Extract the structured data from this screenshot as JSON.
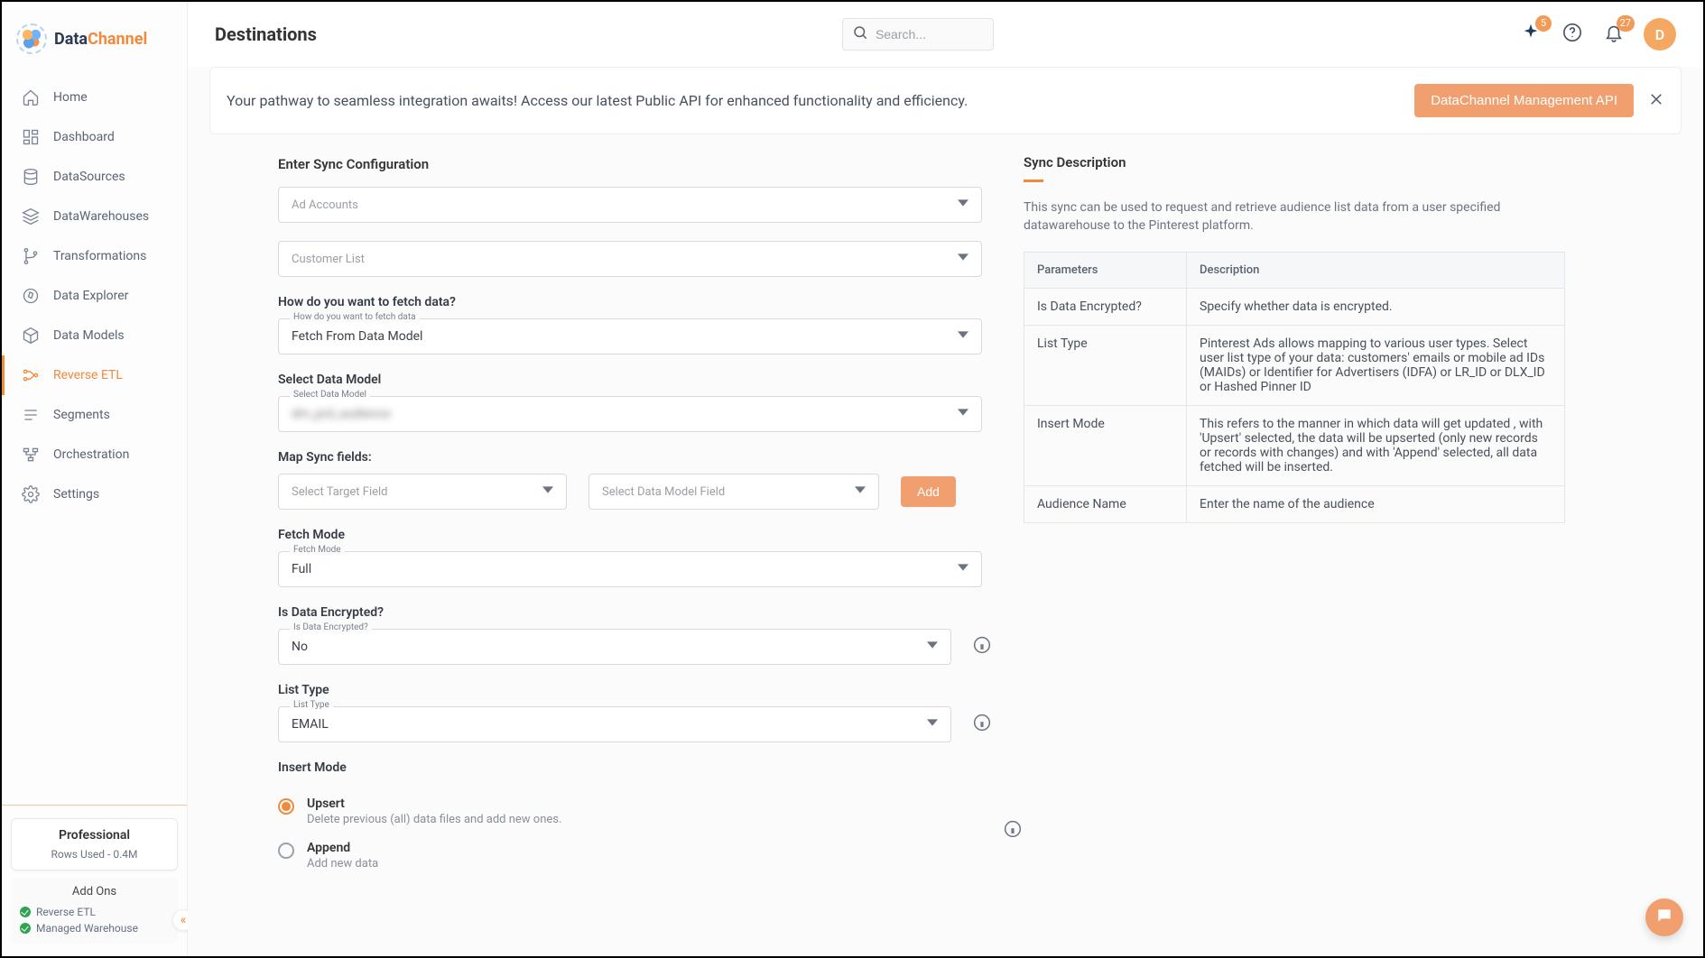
{
  "brand": {
    "name_left": "Data",
    "name_right": "Channel"
  },
  "sidebar": {
    "items": [
      {
        "label": "Home"
      },
      {
        "label": "Dashboard"
      },
      {
        "label": "DataSources"
      },
      {
        "label": "DataWarehouses"
      },
      {
        "label": "Transformations"
      },
      {
        "label": "Data Explorer"
      },
      {
        "label": "Data Models"
      },
      {
        "label": "Reverse ETL"
      },
      {
        "label": "Segments"
      },
      {
        "label": "Orchestration"
      },
      {
        "label": "Settings"
      }
    ],
    "plan": {
      "name": "Professional",
      "rows_used": "Rows Used - 0.4M"
    },
    "addons": {
      "title": "Add Ons",
      "items": [
        "Reverse ETL",
        "Managed Warehouse"
      ]
    }
  },
  "header": {
    "title": "Destinations",
    "search_placeholder": "Search...",
    "sparkle_badge": "5",
    "bell_badge": "27",
    "avatar_letter": "D"
  },
  "banner": {
    "text": "Your pathway to seamless integration awaits! Access our latest Public API for enhanced functionality and efficiency.",
    "button": "DataChannel Management API"
  },
  "form": {
    "heading": "Enter Sync Configuration",
    "ad_accounts_placeholder": "Ad Accounts",
    "customer_list_placeholder": "Customer List",
    "fetch_question": "How do you want to fetch data?",
    "fetch_float": "How do you want to fetch data",
    "fetch_value": "Fetch From Data Model",
    "select_model_label": "Select Data Model",
    "select_model_float": "Select Data Model",
    "select_model_value": "dm_prd_audience",
    "map_label": "Map Sync fields:",
    "target_placeholder": "Select Target Field",
    "model_field_placeholder": "Select Data Model Field",
    "add_btn": "Add",
    "fetch_mode_label": "Fetch Mode",
    "fetch_mode_float": "Fetch Mode",
    "fetch_mode_value": "Full",
    "encrypted_label": "Is Data Encrypted?",
    "encrypted_float": "Is Data Encrypted?",
    "encrypted_value": "No",
    "list_type_label": "List Type",
    "list_type_float": "List Type",
    "list_type_value": "EMAIL",
    "insert_mode_label": "Insert Mode",
    "insert_modes": [
      {
        "title": "Upsert",
        "sub": "Delete previous (all) data files and add new ones."
      },
      {
        "title": "Append",
        "sub": "Add new data"
      }
    ]
  },
  "desc": {
    "heading": "Sync Description",
    "text": "This sync can be used to request and retrieve audience list data from a user specified datawarehouse to the Pinterest platform.",
    "table": {
      "headers": [
        "Parameters",
        "Description"
      ],
      "rows": [
        [
          "Is Data Encrypted?",
          "Specify whether data is encrypted."
        ],
        [
          "List Type",
          "Pinterest Ads allows mapping to various user types. Select user list type of your data: customers' emails or mobile ad IDs (MAIDs) or Identifier for Advertisers (IDFA) or LR_ID or DLX_ID or Hashed Pinner ID"
        ],
        [
          "Insert Mode",
          "This refers to the manner in which data will get updated , with 'Upsert' selected, the data will be upserted (only new records or records with changes) and with 'Append' selected, all data fetched will be inserted."
        ],
        [
          "Audience Name",
          "Enter the name of the audience"
        ]
      ]
    }
  }
}
